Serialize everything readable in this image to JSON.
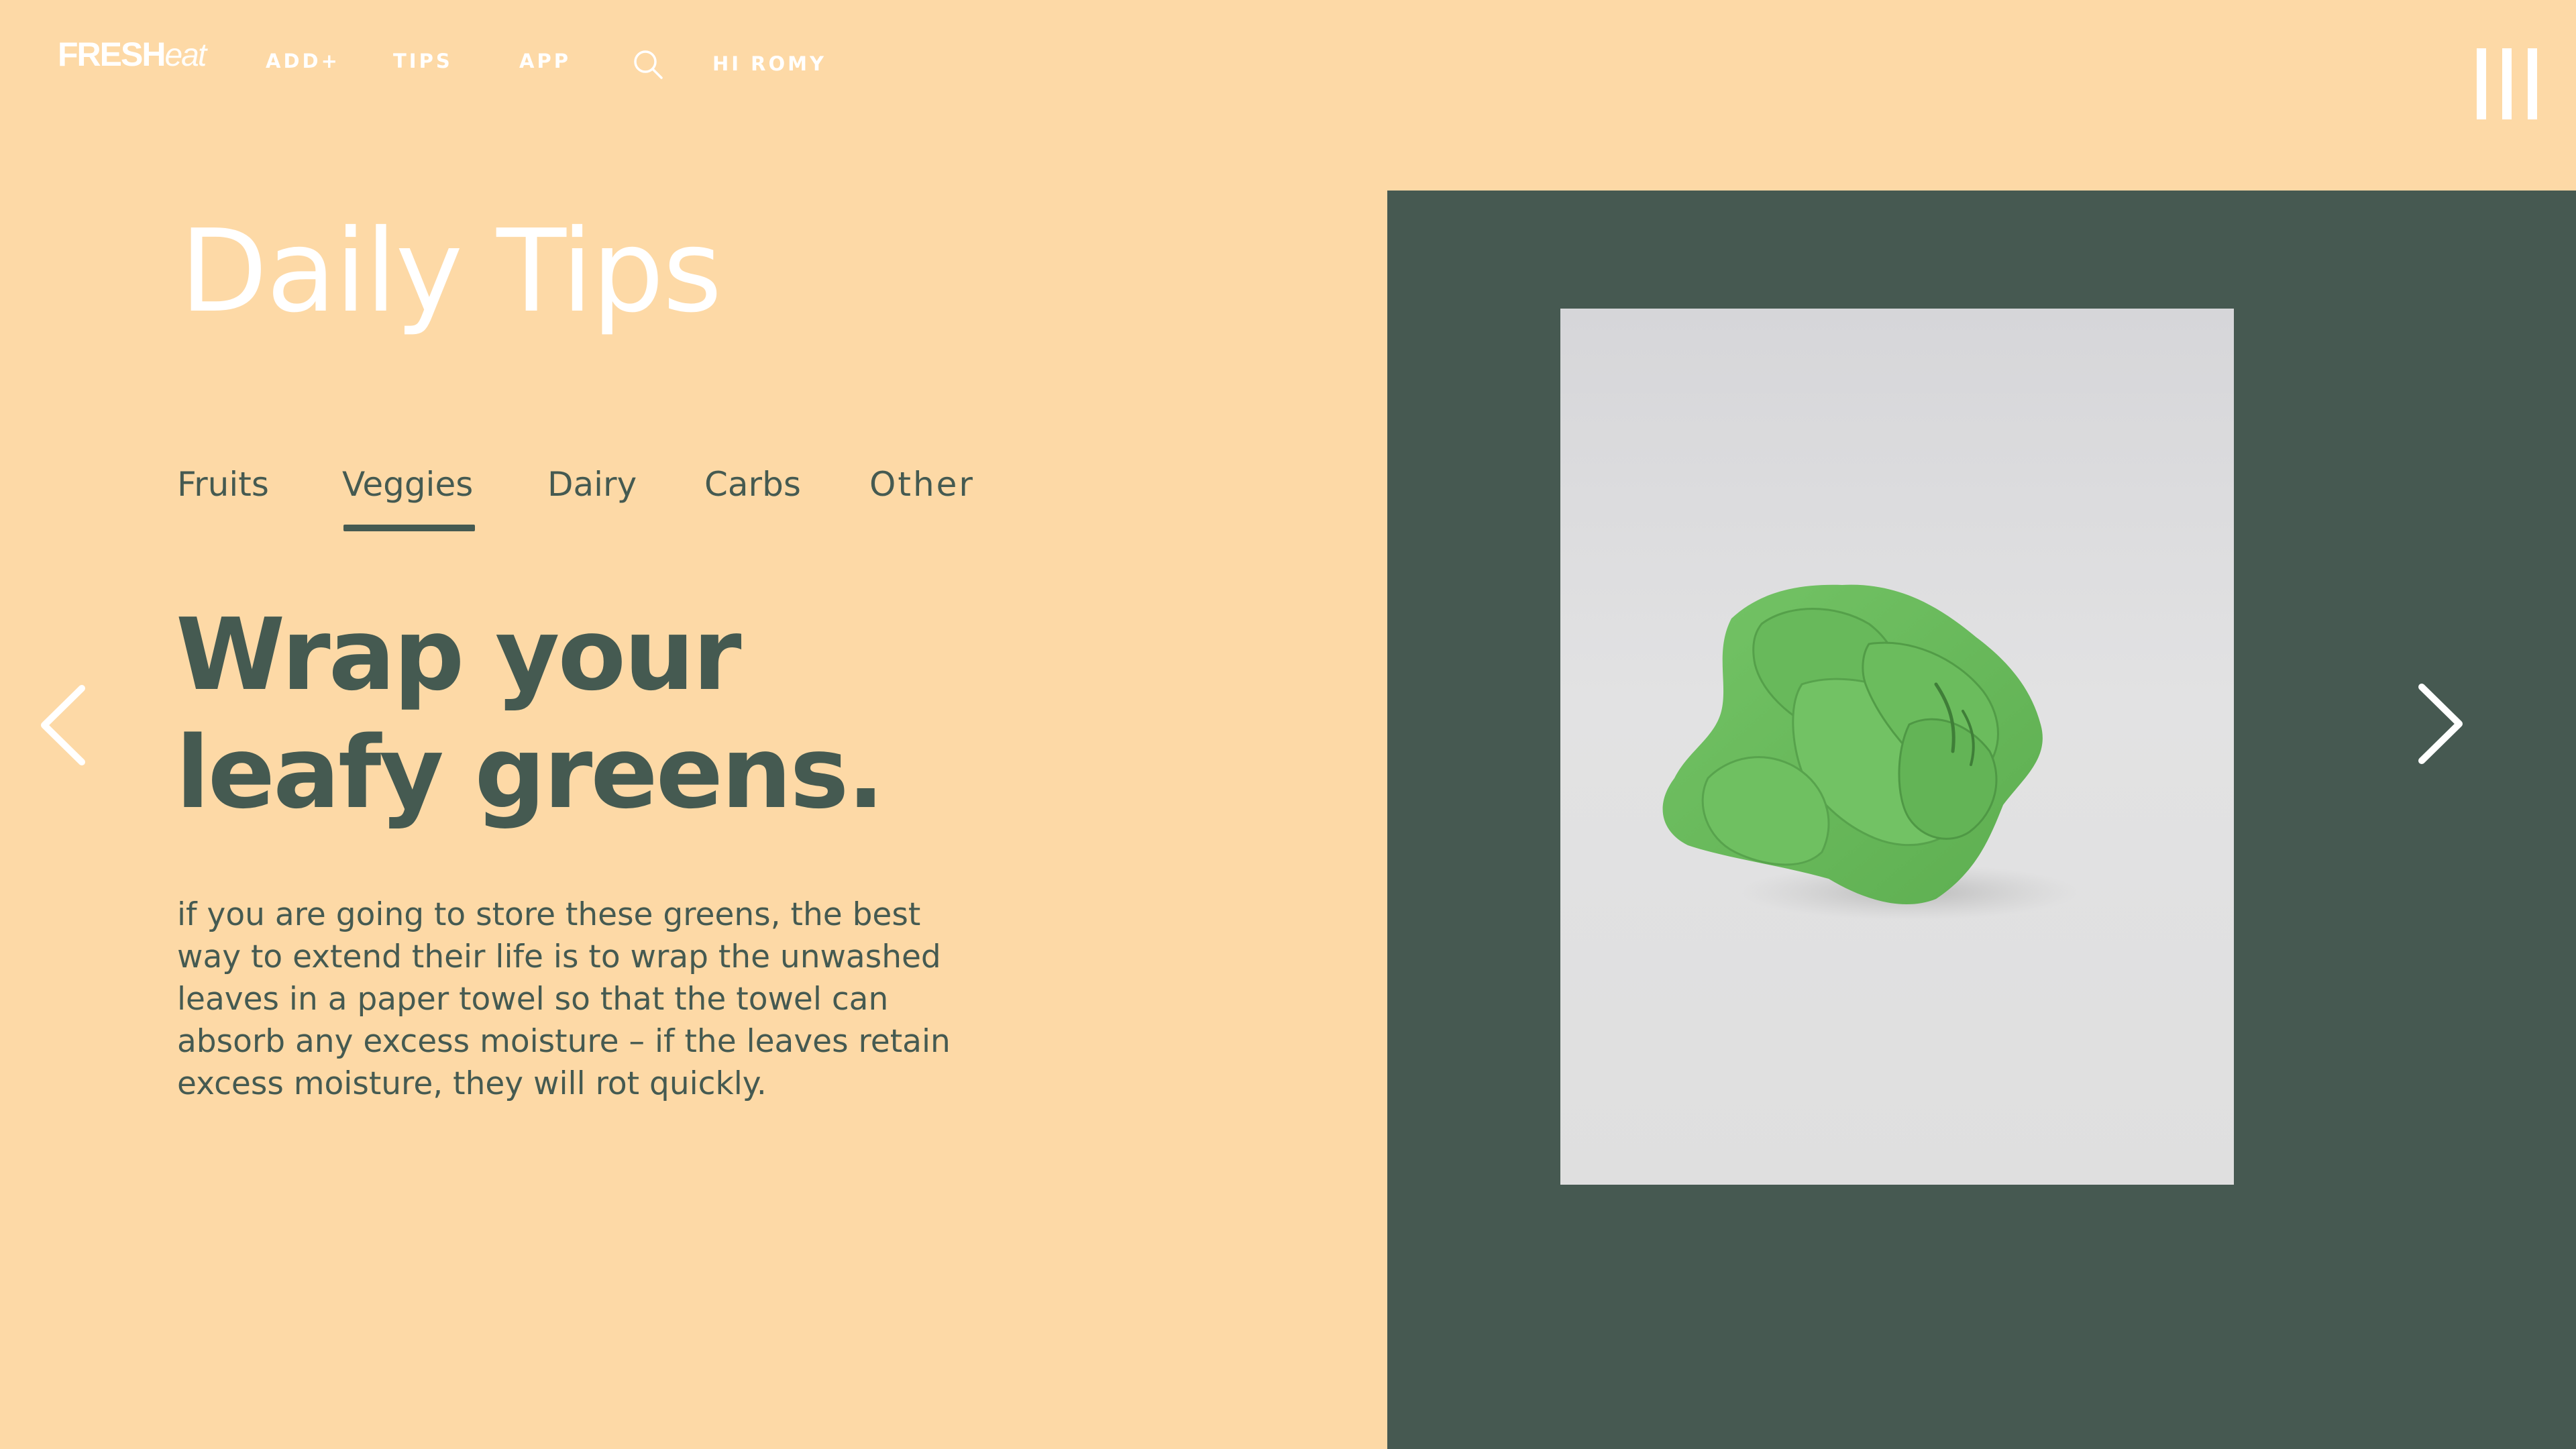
{
  "nav": {
    "logo_strong": "FRESH",
    "logo_light": "eat",
    "links": [
      "ADD+",
      "TIPS",
      "APP"
    ],
    "greeting": "HI ROMY",
    "search_icon": "search-icon",
    "menu_icon": "menu-icon"
  },
  "page": {
    "title": "Daily Tips"
  },
  "tabs": {
    "items": [
      "Fruits",
      "Veggies",
      "Dairy",
      "Carbs",
      "Other"
    ],
    "active": "Veggies"
  },
  "tip": {
    "headline_line1": "Wrap your",
    "headline_line2": "leafy greens.",
    "body_lines": [
      "if you are going to store these greens, the best",
      "way to extend their life is to wrap the unwashed",
      "leaves in a paper towel so that the towel can",
      "absorb any excess moisture – if the leaves retain",
      "excess moisture, they will rot quickly."
    ]
  },
  "controls": {
    "prev_icon": "chevron-left-icon",
    "next_icon": "chevron-right-icon"
  },
  "colors": {
    "background": "#FDD9A6",
    "accent_dark": "#455A51",
    "panel": "#465951",
    "text_light": "#FFFFFF",
    "leaf_green": "#6CBE5E"
  }
}
